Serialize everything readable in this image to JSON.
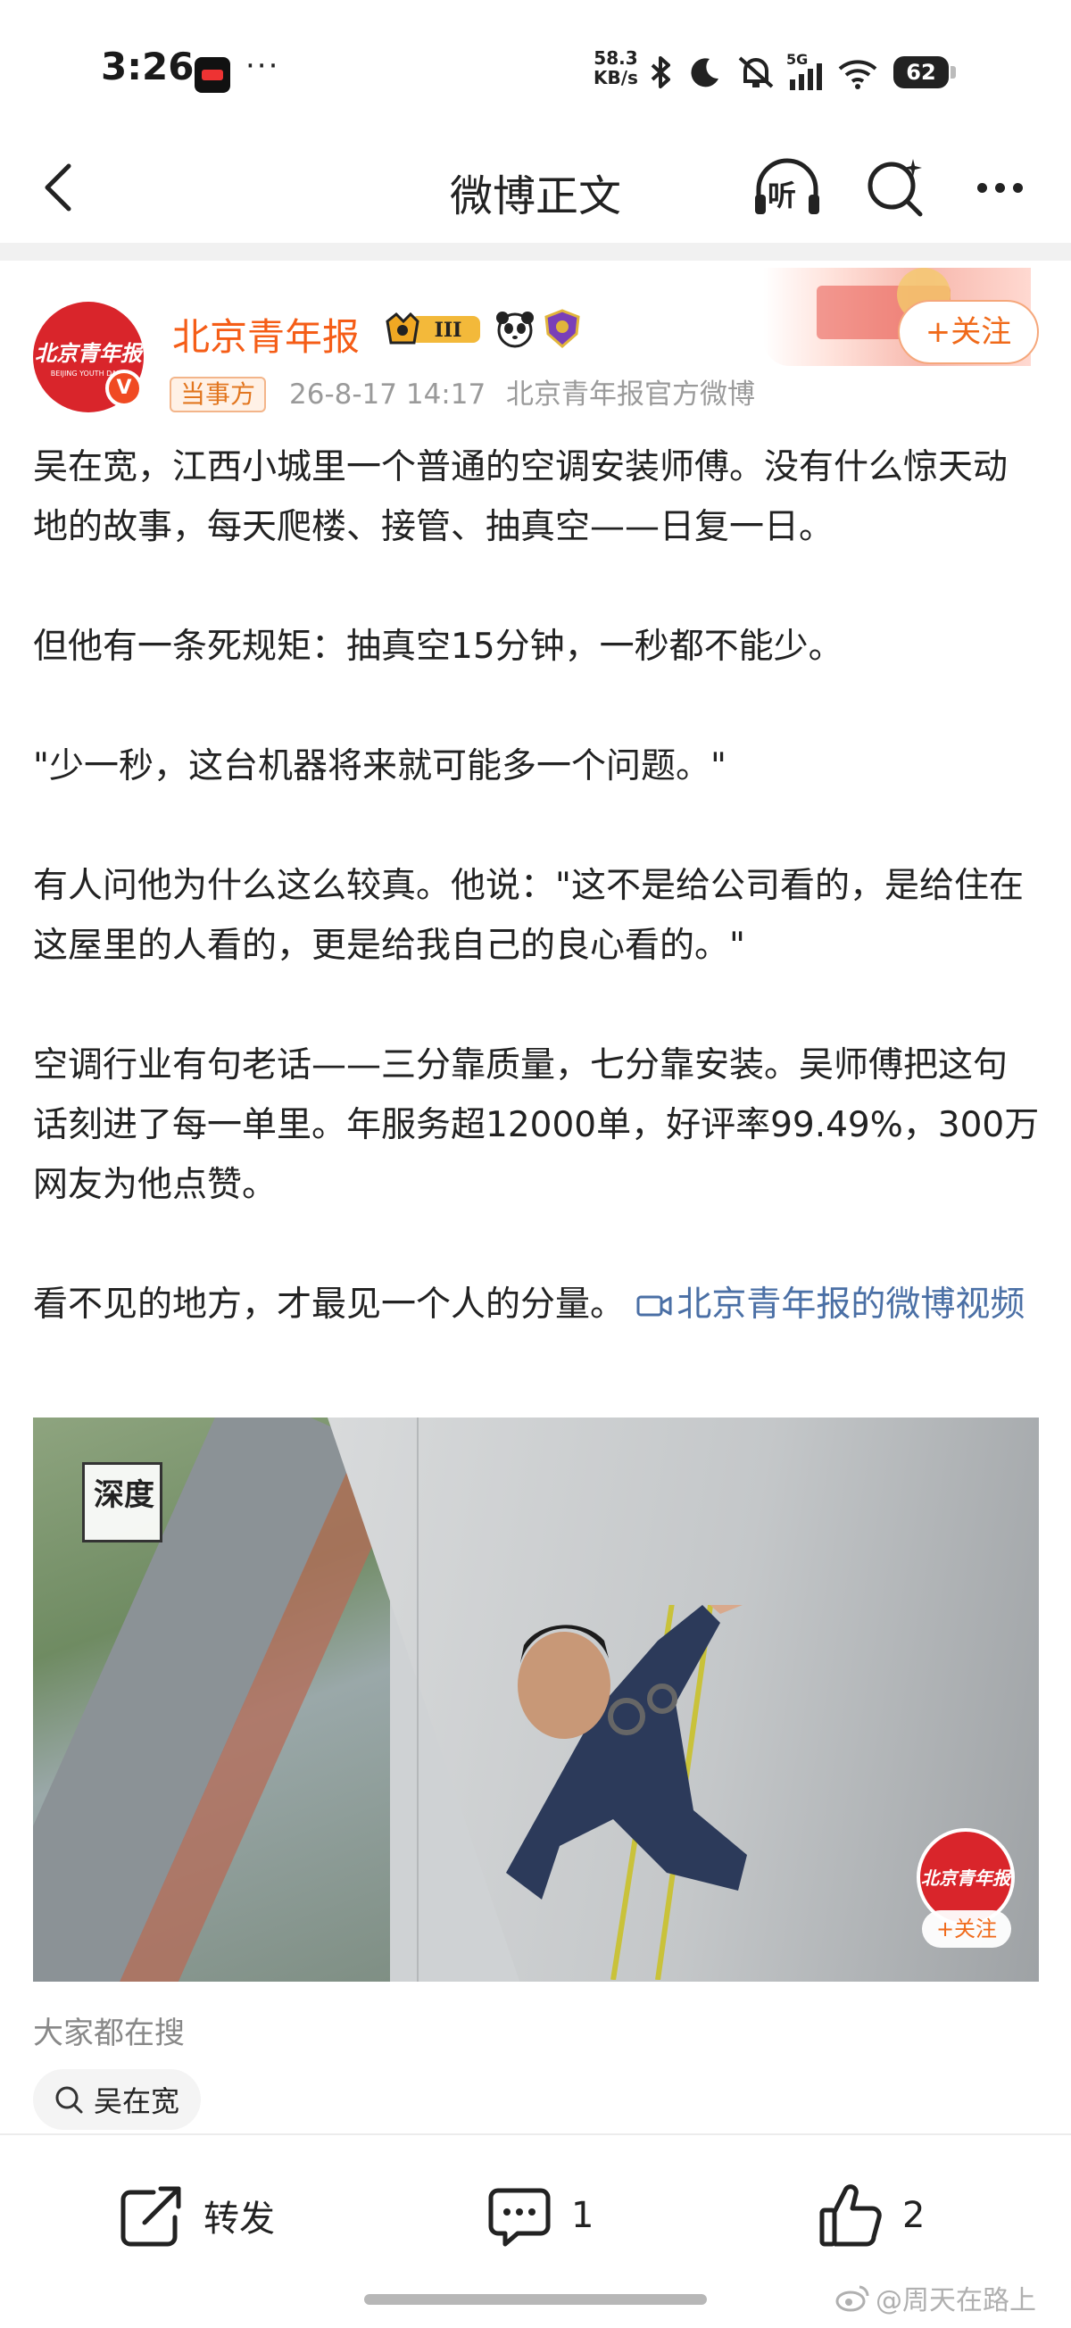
{
  "status_bar": {
    "time": "3:26",
    "dots": "···",
    "net_speed_value": "58.3",
    "net_speed_unit": "KB/s",
    "network": "5G",
    "battery": "62"
  },
  "nav": {
    "title": "微博正文",
    "listen_label": "听"
  },
  "author": {
    "name": "北京青年报",
    "vip_level": "III",
    "avatar_text": "北京青年报",
    "avatar_subtext": "BEIJING YOUTH DAILY",
    "tag": "当事方",
    "time": "26-8-17 14:17",
    "source": "北京青年报官方微博",
    "follow_label": "+关注",
    "verified_mark": "V",
    "brand_color": "#f55d17"
  },
  "post": {
    "paragraphs": [
      "吴在宽，江西小城里一个普通的空调安装师傅。没有什么惊天动地的故事，每天爬楼、接管、抽真空——日复一日。",
      "但他有一条死规矩：抽真空15分钟，一秒都不能少。",
      "\"少一秒，这台机器将来就可能多一个问题。\"",
      "有人问他为什么这么较真。他说：\"这不是给公司看的，是给住在这屋里的人看的，更是给我自己的良心看的。\"",
      "空调行业有句老话——三分靠质量，七分靠安装。吴师傅把这句话刻进了每一单里。年服务超12000单，好评率99.49%，300万网友为他点赞。"
    ],
    "last_paragraph_text": "看不见的地方，才最见一个人的分量。",
    "video_link_text": "北京青年报的微博视频",
    "link_color": "#4a6fa5"
  },
  "video": {
    "watermark_text": "深度",
    "logo_text": "北京青年报",
    "follow_label": "+关注"
  },
  "trending": {
    "label": "大家都在搜",
    "chips": [
      "吴在宽"
    ]
  },
  "actions": {
    "repost_label": "转发",
    "comment_count": "1",
    "like_count": "2"
  },
  "watermark": {
    "text": "@周天在路上"
  }
}
